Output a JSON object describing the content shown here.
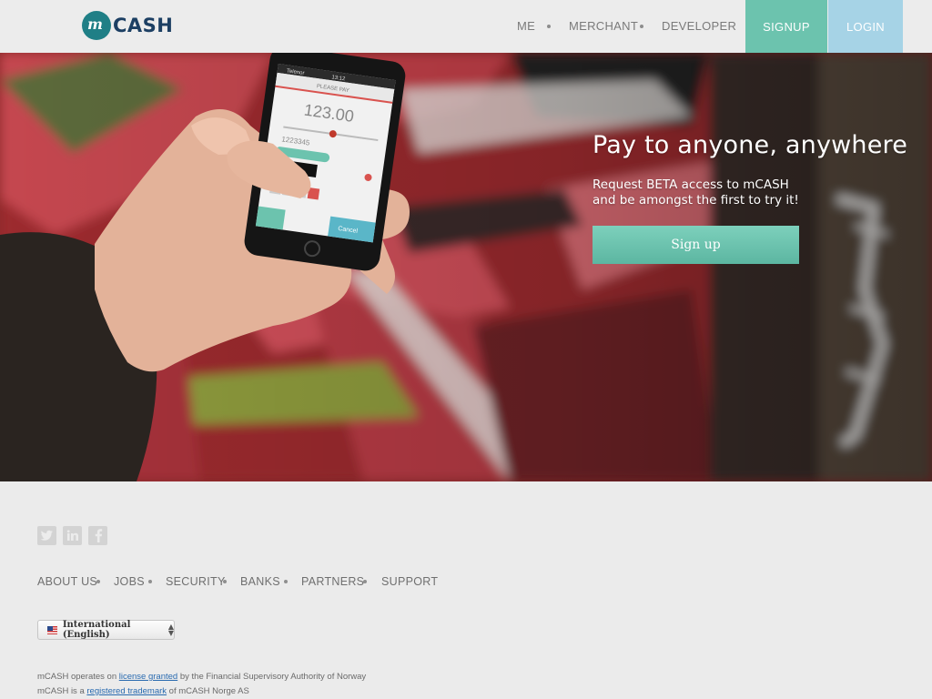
{
  "brand": {
    "logo_mark": "m",
    "name": "CASH"
  },
  "nav": {
    "items": [
      "ME",
      "MERCHANT",
      "DEVELOPER"
    ],
    "signup": "SIGNUP",
    "login": "LOGIN"
  },
  "hero": {
    "title": "Pay to anyone, anywhere",
    "subtitle_line1": "Request BETA access to mCASH",
    "subtitle_line2": "and be amongst the first to try it!",
    "cta": "Sign up",
    "phone": {
      "status": "Telenor",
      "time": "13:12",
      "header": "PLEASE PAY",
      "amount": "123.00",
      "ref": "1223345",
      "cancel": "Cancel"
    }
  },
  "social": {
    "icons": [
      "twitter-icon",
      "linkedin-icon",
      "facebook-icon"
    ]
  },
  "footer": {
    "links": [
      "ABOUT US",
      "JOBS",
      "SECURITY",
      "BANKS",
      "PARTNERS",
      "SUPPORT"
    ],
    "language": "International (English)",
    "legal1_pre": "mCASH operates on ",
    "legal1_link": "license granted",
    "legal1_post": " by the Financial Supervisory Authority of Norway",
    "legal2_pre": "mCASH is a ",
    "legal2_link": "registered trademark",
    "legal2_post": " of mCASH Norge AS"
  },
  "colors": {
    "accent_teal": "#6cc3ae",
    "accent_blue": "#a6d3e6",
    "brand_dark": "#1c3f63"
  }
}
